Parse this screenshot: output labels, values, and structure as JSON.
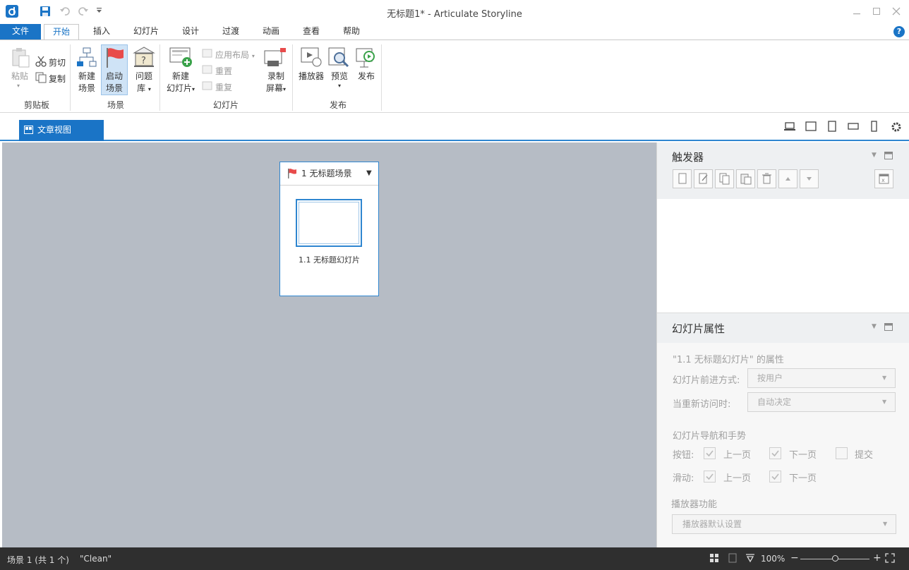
{
  "app": {
    "title": "无标题1* -  Articulate Storyline"
  },
  "menu": {
    "tabs": [
      "文件",
      "开始",
      "插入",
      "幻灯片",
      "设计",
      "过渡",
      "动画",
      "查看",
      "帮助"
    ]
  },
  "ribbon": {
    "clipboard": {
      "paste": "粘贴",
      "cut": "剪切",
      "copy": "复制",
      "group": "剪贴板"
    },
    "scene": {
      "new_scene_1": "新建",
      "new_scene_2": "场景",
      "start_scene_1": "启动",
      "start_scene_2": "场景",
      "question_bank_1": "问题",
      "question_bank_2": "库",
      "group": "场景"
    },
    "slide": {
      "new_slide_1": "新建",
      "new_slide_2": "幻灯片",
      "apply_layout": "应用布局",
      "reset": "重置",
      "duplicate": "重复",
      "record_1": "录制",
      "record_2": "屏幕",
      "group": "幻灯片"
    },
    "publish": {
      "player": "播放器",
      "preview": "预览",
      "publish": "发布",
      "group": "发布"
    }
  },
  "view": {
    "story_view_tab": "文章视图"
  },
  "canvas": {
    "scene_title": "1 无标题场景",
    "slide_label": "1.1 无标题幻灯片"
  },
  "triggers": {
    "title": "触发器"
  },
  "slide_props": {
    "title": "幻灯片属性",
    "heading": "\"1.1 无标题幻灯片\" 的属性",
    "advance_label": "幻灯片前进方式:",
    "advance_value": "按用户",
    "revisit_label": "当重新访问时:",
    "revisit_value": "自动决定",
    "nav_heading": "幻灯片导航和手势",
    "buttons_label": "按钮:",
    "prev": "上一页",
    "next": "下一页",
    "submit": "提交",
    "swipe_label": "滑动:",
    "player_heading": "播放器功能",
    "player_value": "播放器默认设置"
  },
  "status": {
    "scene_info": "场景 1 (共 1 个)",
    "state": "\"Clean\"",
    "zoom": "100%"
  },
  "colors": {
    "accent": "#1a74c6",
    "canvas": "#b6bcc5",
    "statusbar": "#2f2f2f"
  }
}
